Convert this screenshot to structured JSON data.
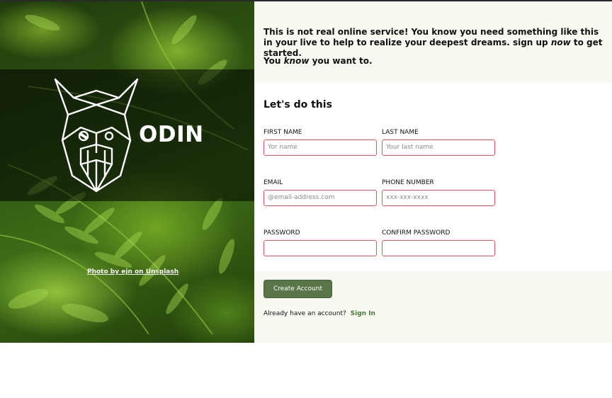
{
  "hero": {
    "brand": "ODIN",
    "photo_credit": "Photo by ejn on Unsplash"
  },
  "intro": {
    "line1_a": "This is not real online service! You know you need something like this in your live to help to realize your deepest dreams. sign up ",
    "line1_em": "now",
    "line1_b": " to get started.",
    "line2_a": "You ",
    "line2_em": "know",
    "line2_b": " you want to."
  },
  "form": {
    "title": "Let's do this",
    "first_name": {
      "label": "FIRST NAME",
      "placeholder": "Yor name"
    },
    "last_name": {
      "label": "LAST NAME",
      "placeholder": "Your last name"
    },
    "email": {
      "label": "EMAIL",
      "placeholder": "@email-address.com"
    },
    "phone": {
      "label": "PHONE NUMBER",
      "placeholder": "xxx-xxx-xxxx"
    },
    "password": {
      "label": "PASSWORD",
      "placeholder": ""
    },
    "confirm_password": {
      "label": "CONFIRM PASSWORD",
      "placeholder": ""
    }
  },
  "footer": {
    "create_button": "Create Account",
    "already_text": "Already have an account?",
    "sign_in_link": "Sign In"
  },
  "colors": {
    "accent_green": "#5a7648",
    "link_green": "#4a7a3a",
    "input_border": "#e15757",
    "panel_bg": "#f8f9f1"
  }
}
